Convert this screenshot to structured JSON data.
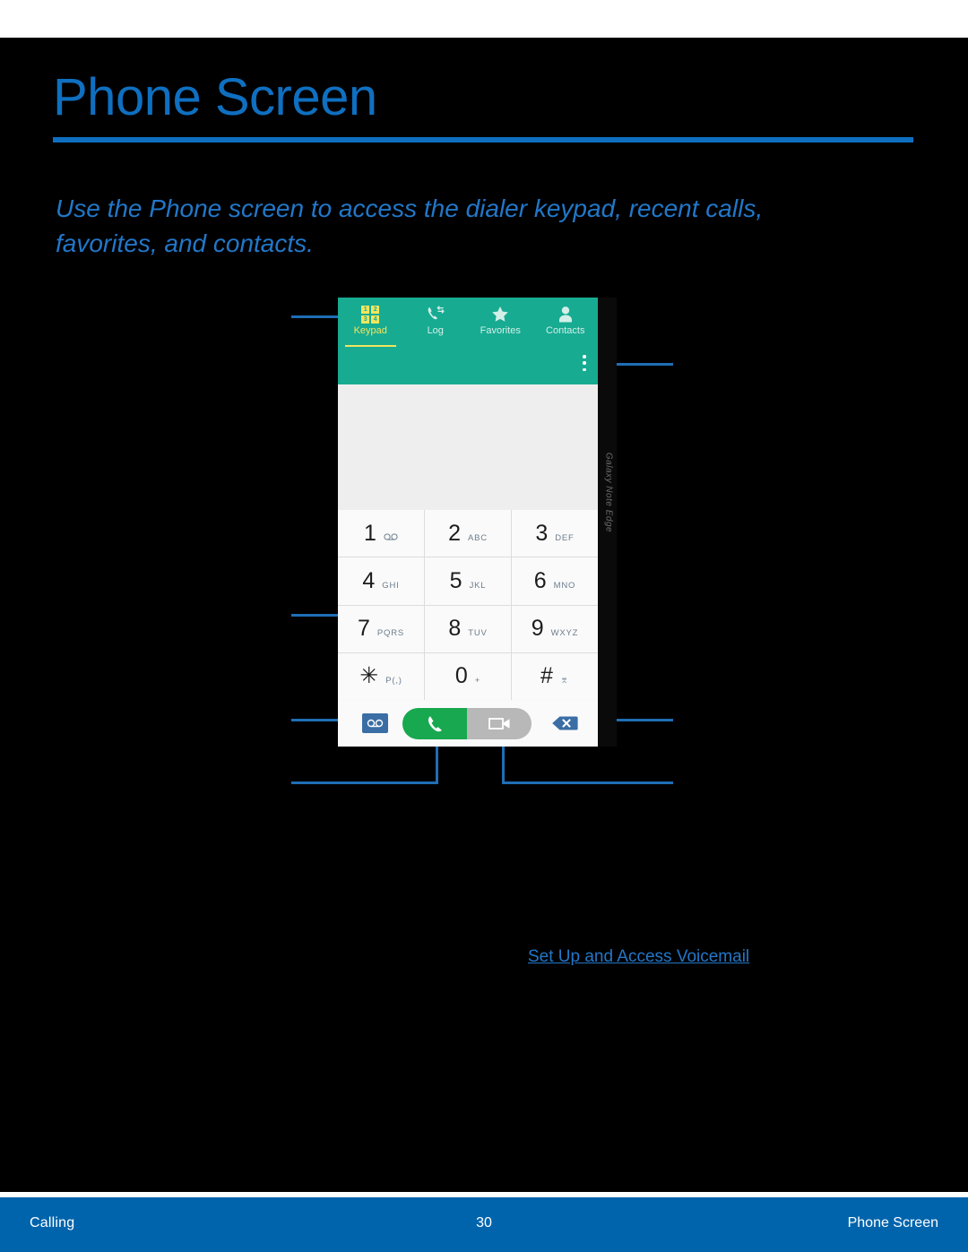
{
  "document": {
    "title": "Phone Screen",
    "subtitle": "Use the Phone screen to access the dialer keypad, recent calls, favorites, and contacts.",
    "link": "Set Up and Access Voicemail"
  },
  "footer": {
    "left": "Calling",
    "page": "30",
    "right": "Phone Screen"
  },
  "device": {
    "edge_label": "Galaxy Note Edge"
  },
  "phone_ui": {
    "tabs": [
      {
        "label": "Keypad",
        "icon": "keypad-grid-icon",
        "active": true
      },
      {
        "label": "Log",
        "icon": "call-log-icon",
        "active": false
      },
      {
        "label": "Favorites",
        "icon": "star-icon",
        "active": false
      },
      {
        "label": "Contacts",
        "icon": "person-icon",
        "active": false
      }
    ],
    "keypad_icon_digits": [
      "1",
      "2",
      "3",
      "4"
    ],
    "overflow_menu": "more-options-icon",
    "number_display": "",
    "keys": [
      {
        "digit": "1",
        "sub": "⊙⊙",
        "sub_kind": "voicemail"
      },
      {
        "digit": "2",
        "sub": "ABC",
        "sub_kind": "letters"
      },
      {
        "digit": "3",
        "sub": "DEF",
        "sub_kind": "letters"
      },
      {
        "digit": "4",
        "sub": "GHI",
        "sub_kind": "letters"
      },
      {
        "digit": "5",
        "sub": "JKL",
        "sub_kind": "letters"
      },
      {
        "digit": "6",
        "sub": "MNO",
        "sub_kind": "letters"
      },
      {
        "digit": "7",
        "sub": "PQRS",
        "sub_kind": "letters"
      },
      {
        "digit": "8",
        "sub": "TUV",
        "sub_kind": "letters"
      },
      {
        "digit": "9",
        "sub": "WXYZ",
        "sub_kind": "letters"
      },
      {
        "digit": "✳",
        "sub": "P(,)",
        "sub_kind": "letters"
      },
      {
        "digit": "0",
        "sub": "+",
        "sub_kind": "letters"
      },
      {
        "digit": "#",
        "sub": "⌆",
        "sub_kind": "symbol"
      }
    ],
    "actions": {
      "voicemail": "voicemail-button",
      "call": "call-button",
      "video_call": "video-call-button",
      "delete": "backspace-delete-button"
    }
  },
  "colors": {
    "accent_blue": "#0f6fc0",
    "subtitle_blue": "#2277c8",
    "footer_blue": "#0064ac",
    "app_teal": "#17ab92",
    "tab_active_yellow": "#f2e55c",
    "call_green": "#18a84f",
    "video_gray": "#b8b8b8",
    "voicemail_blue": "#3a6ea5",
    "leader_line": "#1f6eb5",
    "page_black": "#000000"
  }
}
